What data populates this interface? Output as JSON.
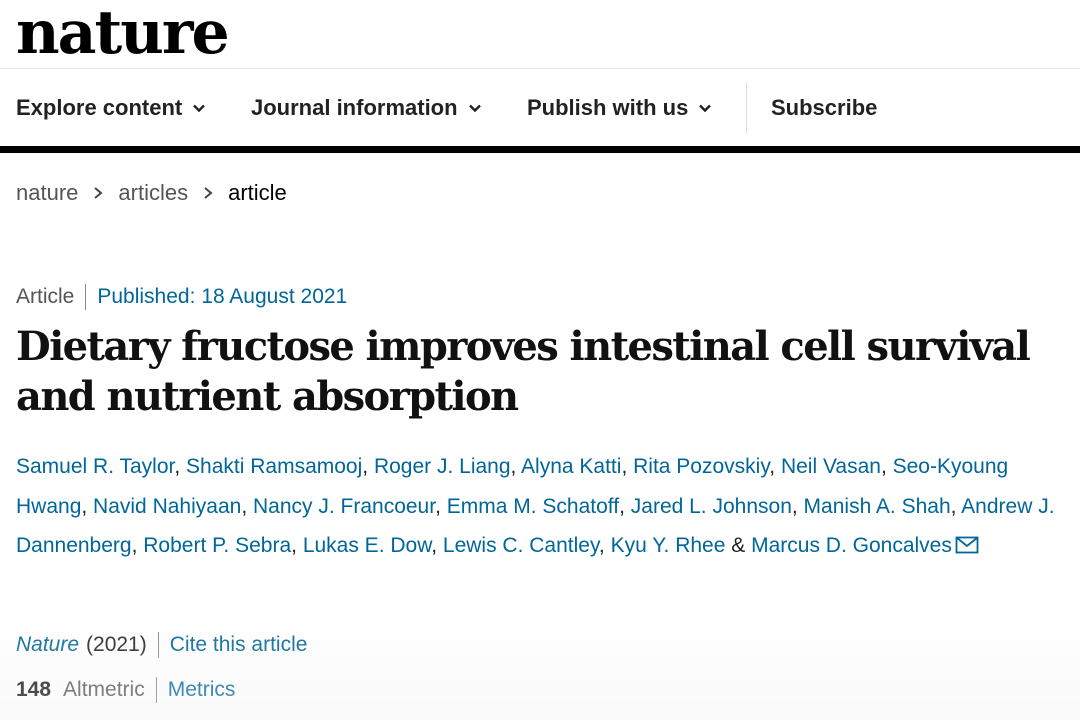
{
  "site": {
    "logo": "nature"
  },
  "nav": {
    "items": [
      {
        "label": "Explore content",
        "icon": "chevron-down-icon"
      },
      {
        "label": "Journal information",
        "icon": "chevron-down-icon"
      },
      {
        "label": "Publish with us",
        "icon": "chevron-down-icon"
      }
    ],
    "subscribe": "Subscribe"
  },
  "breadcrumb": [
    "nature",
    "articles",
    "article"
  ],
  "article": {
    "type": "Article",
    "published": "Published: 18 August 2021",
    "title": "Dietary fructose improves intestinal cell survival and nutrient absorption",
    "authors": [
      "Samuel R. Taylor",
      "Shakti Ramsamooj",
      "Roger J. Liang",
      "Alyna Katti",
      "Rita Pozovskiy",
      "Neil Vasan",
      "Seo-Kyoung Hwang",
      "Navid Nahiyaan",
      "Nancy J. Francoeur",
      "Emma M. Schatoff",
      "Jared L. Johnson",
      "Manish A. Shah",
      "Andrew J. Dannenberg",
      "Robert P. Sebra",
      "Lukas E. Dow",
      "Lewis C. Cantley",
      "Kyu Y. Rhee",
      "Marcus D. Goncalves"
    ],
    "authors_and": "&",
    "corresponding_icon": "mail-icon",
    "journal": "Nature",
    "year": "(2021)",
    "cite": "Cite this article",
    "altmetric_count": "148",
    "altmetric_label": "Altmetric",
    "metrics": "Metrics"
  },
  "colors": {
    "link": "#006699",
    "text": "#222222",
    "bar": "#000000"
  }
}
